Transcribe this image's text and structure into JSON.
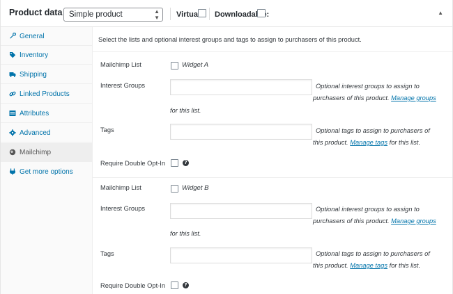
{
  "header": {
    "title": "Product data —",
    "product_type": "Simple product",
    "virtual_label": "Virtual:",
    "downloadable_label": "Downloadable:"
  },
  "sidebar": {
    "items": [
      {
        "label": "General",
        "icon": "wrench-icon"
      },
      {
        "label": "Inventory",
        "icon": "tag-icon"
      },
      {
        "label": "Shipping",
        "icon": "truck-icon"
      },
      {
        "label": "Linked Products",
        "icon": "link-icon"
      },
      {
        "label": "Attributes",
        "icon": "table-icon"
      },
      {
        "label": "Advanced",
        "icon": "gear-icon"
      },
      {
        "label": "Mailchimp",
        "icon": "mailchimp-icon"
      },
      {
        "label": "Get more options",
        "icon": "plugin-icon"
      }
    ],
    "active_item": "Mailchimp"
  },
  "main": {
    "intro": "Select the lists and optional interest groups and tags to assign to purchasers of this product.",
    "blocks": [
      {
        "list_label": "Mailchimp List",
        "list_name": "Widget A",
        "groups_label": "Interest Groups",
        "groups_desc_1": "Optional interest groups to assign to",
        "groups_desc_2": "purchasers of this product.",
        "groups_link": "Manage groups",
        "groups_desc_3": "for this list.",
        "tags_label": "Tags",
        "tags_desc_1": "Optional tags to assign to purchasers of",
        "tags_desc_2": "this product.",
        "tags_link": "Manage tags",
        "tags_desc_3": "for this list.",
        "optin_label": "Require Double Opt-In"
      },
      {
        "list_label": "Mailchimp List",
        "list_name": "Widget B",
        "groups_label": "Interest Groups",
        "groups_desc_1": "Optional interest groups to assign to",
        "groups_desc_2": "purchasers of this product.",
        "groups_link": "Manage groups",
        "groups_desc_3": "for this list.",
        "tags_label": "Tags",
        "tags_desc_1": "Optional tags to assign to purchasers of",
        "tags_desc_2": "this product.",
        "tags_link": "Manage tags",
        "tags_desc_3": "for this list.",
        "optin_label": "Require Double Opt-In"
      }
    ],
    "help_glyph": "?"
  },
  "colors": {
    "link": "#0073aa",
    "text": "#32373c",
    "sidebar_bg": "#fafafa",
    "active_tab_bg": "#eeeeee"
  }
}
